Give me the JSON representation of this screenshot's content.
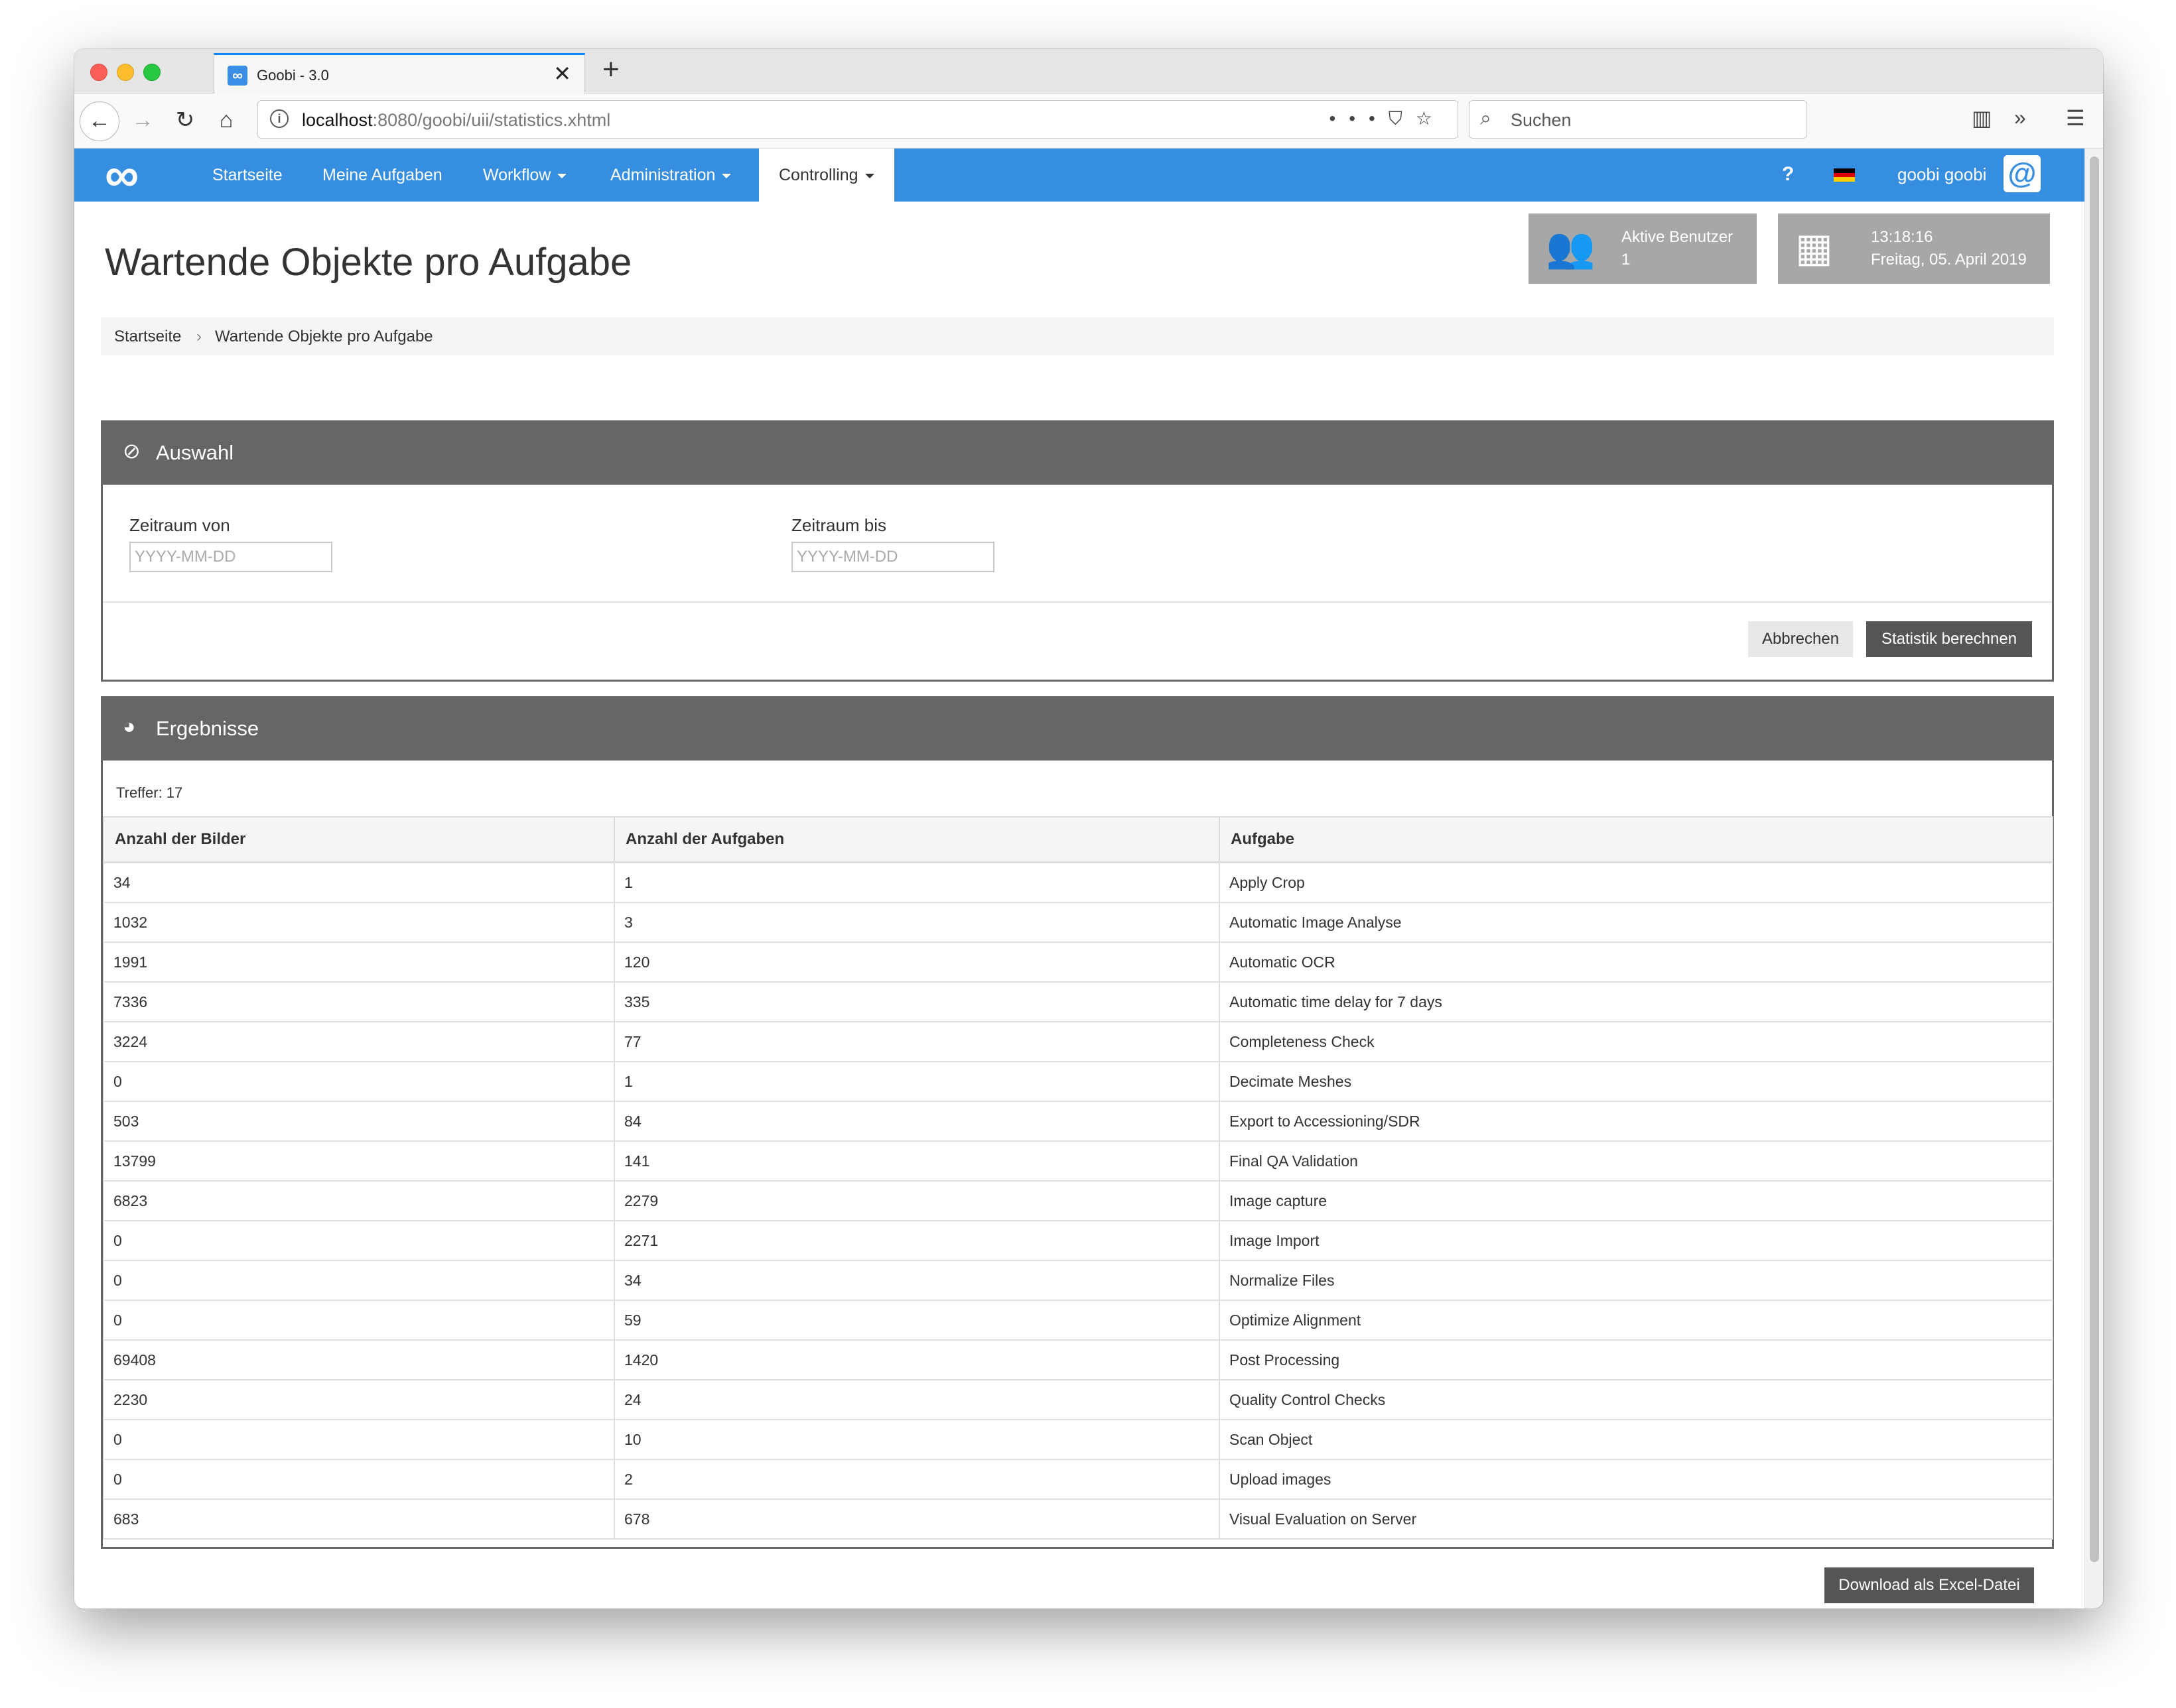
{
  "browser": {
    "tab_title": "Goobi - 3.0",
    "url_host": "localhost",
    "url_rest": ":8080/goobi/uii/statistics.xhtml",
    "search_placeholder": "Suchen"
  },
  "navbar": {
    "items": [
      {
        "label": "Startseite"
      },
      {
        "label": "Meine Aufgaben"
      },
      {
        "label": "Workflow"
      },
      {
        "label": "Administration"
      },
      {
        "label": "Controlling"
      }
    ],
    "active": "Controlling",
    "help": "?",
    "user": "goobi goobi",
    "accent": "#368ee0"
  },
  "page": {
    "title": "Wartende Objekte pro Aufgabe",
    "widgets": {
      "users_label": "Aktive Benutzer",
      "users_count": "1",
      "time": "13:18:16",
      "date": "Freitag, 05. April 2019"
    },
    "breadcrumb": [
      "Startseite",
      "Wartende Objekte pro Aufgabe"
    ]
  },
  "selection": {
    "title": "Auswahl",
    "from_label": "Zeitraum von",
    "from_placeholder": "YYYY-MM-DD",
    "to_label": "Zeitraum bis",
    "to_placeholder": "YYYY-MM-DD",
    "cancel_label": "Abbrechen",
    "compute_label": "Statistik berechnen"
  },
  "results": {
    "title": "Ergebnisse",
    "hits": "Treffer: 17",
    "columns": [
      "Anzahl der Bilder",
      "Anzahl der Aufgaben",
      "Aufgabe"
    ],
    "rows": [
      [
        "34",
        "1",
        "Apply Crop"
      ],
      [
        "1032",
        "3",
        "Automatic Image Analyse"
      ],
      [
        "1991",
        "120",
        "Automatic OCR"
      ],
      [
        "7336",
        "335",
        "Automatic time delay for 7 days"
      ],
      [
        "3224",
        "77",
        "Completeness Check"
      ],
      [
        "0",
        "1",
        "Decimate Meshes"
      ],
      [
        "503",
        "84",
        "Export to Accessioning/SDR"
      ],
      [
        "13799",
        "141",
        "Final QA Validation"
      ],
      [
        "6823",
        "2279",
        "Image capture"
      ],
      [
        "0",
        "2271",
        "Image Import"
      ],
      [
        "0",
        "34",
        "Normalize Files"
      ],
      [
        "0",
        "59",
        "Optimize Alignment"
      ],
      [
        "69408",
        "1420",
        "Post Processing"
      ],
      [
        "2230",
        "24",
        "Quality Control Checks"
      ],
      [
        "0",
        "10",
        "Scan Object"
      ],
      [
        "0",
        "2",
        "Upload images"
      ],
      [
        "683",
        "678",
        "Visual Evaluation on Server"
      ]
    ],
    "download_label": "Download als Excel-Datei"
  }
}
